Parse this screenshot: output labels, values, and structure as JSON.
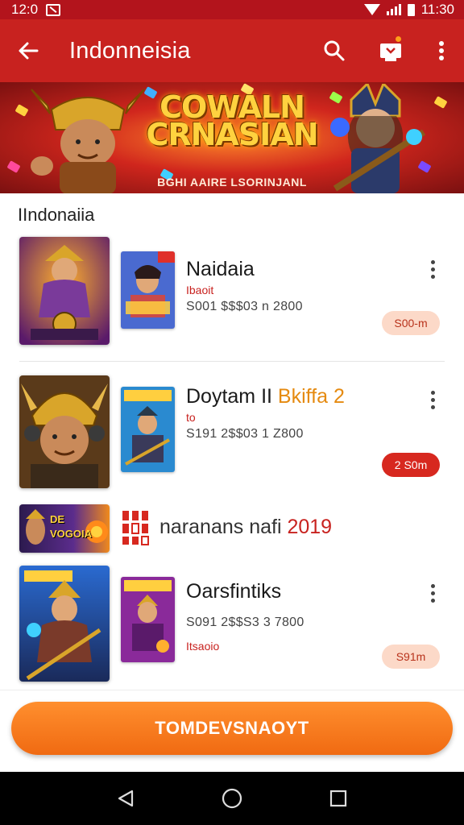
{
  "status_bar": {
    "time_left": "12:0",
    "time_right": "11:30"
  },
  "app_bar": {
    "title": "Indonneisia"
  },
  "banner": {
    "title_line1": "COWALN",
    "title_line2": "CRNASIAN",
    "subtitle": "BGHI AAIRE LSORINJANL"
  },
  "section": {
    "title": "IIndonaiia"
  },
  "items": [
    {
      "title": "Naidaia",
      "title_accent": "",
      "tag": "Ibaoit",
      "meta": "S001 $$$03 n 2800",
      "price": "S00-m",
      "price_style": "light"
    },
    {
      "title": "Doytam II ",
      "title_accent": "Bkiffa 2",
      "tag": "to",
      "meta": "S191 2$$03 1 Z800",
      "price": "2 S0m",
      "price_style": "solid"
    },
    {
      "title": "Oarsfintiks",
      "title_accent": "",
      "tag": "Itsaoio",
      "meta": "S091 2$$S3 3 7800",
      "price": "S91m",
      "price_style": "light"
    }
  ],
  "promo": {
    "thumb_label_line1": "DE",
    "thumb_label_line2": "VOGOIA",
    "text": "naranans nafi ",
    "year": "2019"
  },
  "cta": {
    "label": "TOMDEVSNAOYT"
  },
  "colors": {
    "app_bar": "#c8221f",
    "status_bar": "#b3141c",
    "cta": "#f57a1f",
    "accent": "#e58a10"
  },
  "icons": [
    "back-arrow-icon",
    "search-icon",
    "store-icon",
    "more-vert-icon",
    "back-triangle-icon",
    "home-circle-icon",
    "recents-square-icon"
  ]
}
